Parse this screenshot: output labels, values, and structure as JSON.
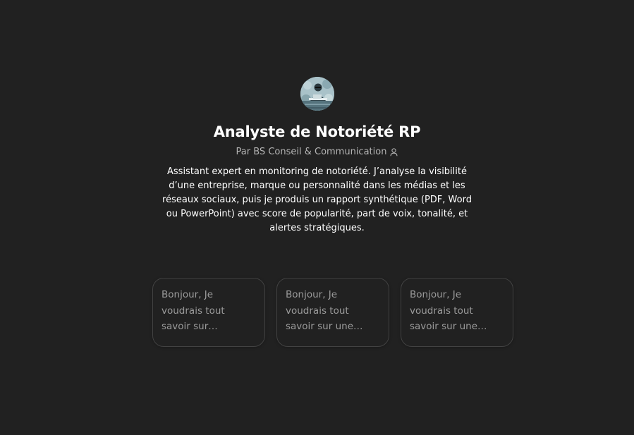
{
  "gpt": {
    "avatar_icon": "gpt-avatar-analyst-image",
    "title": "Analyste de Notoriété RP",
    "byline": "Par BS Conseil & Communication",
    "byline_icon": "person-icon",
    "description": "Assistant expert en monitoring de notoriété. J’analyse la visibilité d’une entreprise, marque ou personnalité dans les médias et les réseaux sociaux, puis je produis un rapport synthétique (PDF, Word ou PowerPoint) avec score de popularité, part de voix, tonalité, et alertes stratégiques."
  },
  "conversation_starters": [
    {
      "text": "Bonjour, Je voudrais tout savoir sur quelqu'un, tu peu…"
    },
    {
      "text": "Bonjour, Je voudrais tout savoir sur une société, tu peux…"
    },
    {
      "text": "Bonjour, Je voudrais tout savoir sur une organisation, tu…"
    }
  ],
  "colors": {
    "background": "#212121",
    "title": "#ffffff",
    "muted": "#b4b4b4",
    "starter_border": "#424242",
    "starter_text": "#9b9b9b"
  }
}
